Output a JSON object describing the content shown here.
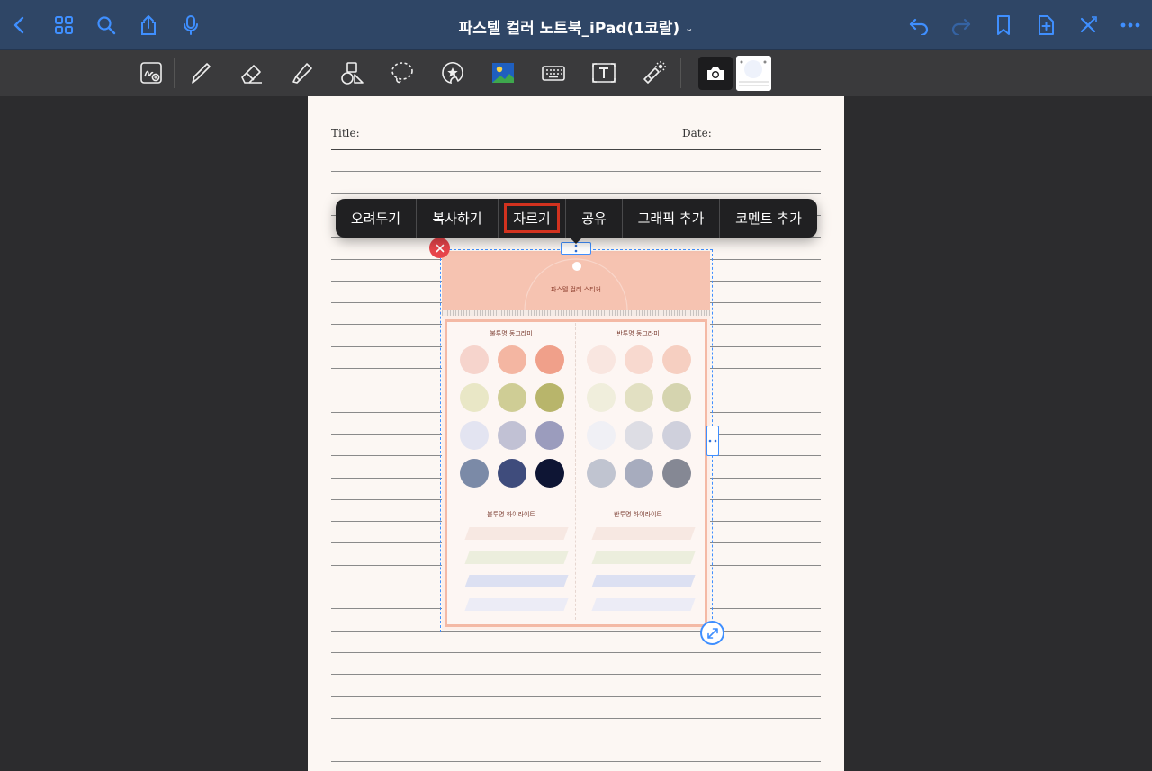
{
  "header": {
    "title": "파스텔 컬러 노트북_iPad(1코랄)",
    "title_chevron": "⌄",
    "left_icons": [
      "back-icon",
      "grid-icon",
      "search-icon",
      "share-icon",
      "microphone-icon"
    ],
    "right_icons": [
      "undo-icon",
      "redo-icon",
      "bookmark-icon",
      "add-page-icon",
      "close-edit-icon",
      "more-icon"
    ],
    "accent_color": "#3f8fff",
    "bar_color": "#2f4666"
  },
  "toolbar": {
    "tools": [
      "zoom-write-icon",
      "pen-icon",
      "eraser-icon",
      "highlighter-icon",
      "shapes-icon",
      "lasso-icon",
      "sticker-icon",
      "image-icon",
      "keyboard-icon",
      "text-icon",
      "laser-pointer-icon"
    ],
    "camera_icon": "camera-icon"
  },
  "page": {
    "title_label": "Title:",
    "date_label": "Date:",
    "background": "#fcf7f3"
  },
  "context_menu": {
    "items": [
      "오려두기",
      "복사하기",
      "자르기",
      "공유",
      "그래픽 추가",
      "코멘트 추가"
    ],
    "highlighted": "자르기",
    "highlight_color": "#d2321f"
  },
  "sticker": {
    "logo_text": "파스텔 컬러 스티커",
    "left_label": "불투명 동그라미",
    "right_label": "반투명 동그라미",
    "left_band_label": "불투명 하이라이트",
    "right_band_label": "반투명 하이라이트",
    "colors_left": [
      "#f6d4cc",
      "#f4b6a2",
      "#f0a08a",
      "#e9e7c6",
      "#cfcd95",
      "#b8b56b",
      "#e3e4f1",
      "#c1c1d4",
      "#9b9cbd",
      "#7b8aa7",
      "#3f4c7c",
      "#0e1534"
    ],
    "colors_right": [
      "#f9e6e0",
      "#f8d9cf",
      "#f6cfc1",
      "#f0eedc",
      "#e2e0c2",
      "#d5d4af",
      "#f0f0f5",
      "#dddde4",
      "#cfd0dc",
      "#c0c4d0",
      "#a7acbe",
      "#858894"
    ],
    "band_colors": [
      "#f7e8e2",
      "#eceedd",
      "#dce0f2",
      "#ececf6"
    ]
  }
}
